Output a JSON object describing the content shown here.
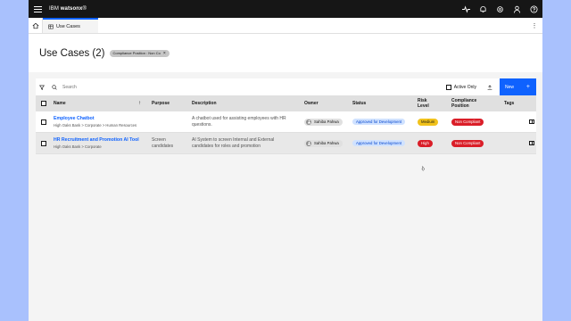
{
  "app": {
    "brand_prefix": "IBM",
    "brand_name": "watsonx",
    "brand_suffix": "®"
  },
  "topbar": {
    "icons": [
      "ai-sparkle-icon",
      "notification-icon",
      "settings-icon",
      "user-icon",
      "help-icon"
    ]
  },
  "tabs": [
    {
      "label": "Use Cases",
      "icon": "table-icon"
    }
  ],
  "header": {
    "title": "Use Cases (2)",
    "filter_tag": "Compliance Position : Non Co",
    "filter_tag_close": "×"
  },
  "toolbar": {
    "search_placeholder": "Search",
    "active_only_label": "Active Only",
    "new_button_label": "New",
    "new_button_icon": "+"
  },
  "table": {
    "columns": {
      "name": "Name",
      "sort": "↑",
      "purpose": "Purpose",
      "description": "Description",
      "owner": "Owner",
      "status": "Status",
      "risk_1": "Risk",
      "risk_2": "Level",
      "compliance_1": "Compliance",
      "compliance_2": "Position",
      "tags": "Tags"
    },
    "rows": [
      {
        "name": "Employee Chatbot",
        "path": "High Oaks Bank > Corporate > Human Resources",
        "purpose_1": "",
        "purpose_2": "",
        "description_1": "A chatbot used for assisting employees with HR",
        "description_2": "questions.",
        "owner": "Sahiba Pahwa",
        "status": "Approved for Development",
        "risk": "Medium",
        "compliance": "Non Compliant"
      },
      {
        "name": "HR Recruitment and Promotion AI Tool",
        "path": "High Oaks Bank > Corporate",
        "purpose_1": "Screen",
        "purpose_2": "candidates",
        "description_1": "AI System to screen Internal and External",
        "description_2": "candidates for roles and promotion",
        "owner": "Sahiba Pahwa",
        "status": "Approved for Development",
        "risk": "High",
        "compliance": "Non Compliant"
      }
    ]
  },
  "colors": {
    "accent": "#0f62fe",
    "topbar": "#161616",
    "risk_medium": "#f1c21b",
    "risk_high": "#da1e28",
    "non_compliant": "#da1e28",
    "status_tag": "#d0e2ff",
    "backdrop": "#a9c1fd"
  }
}
